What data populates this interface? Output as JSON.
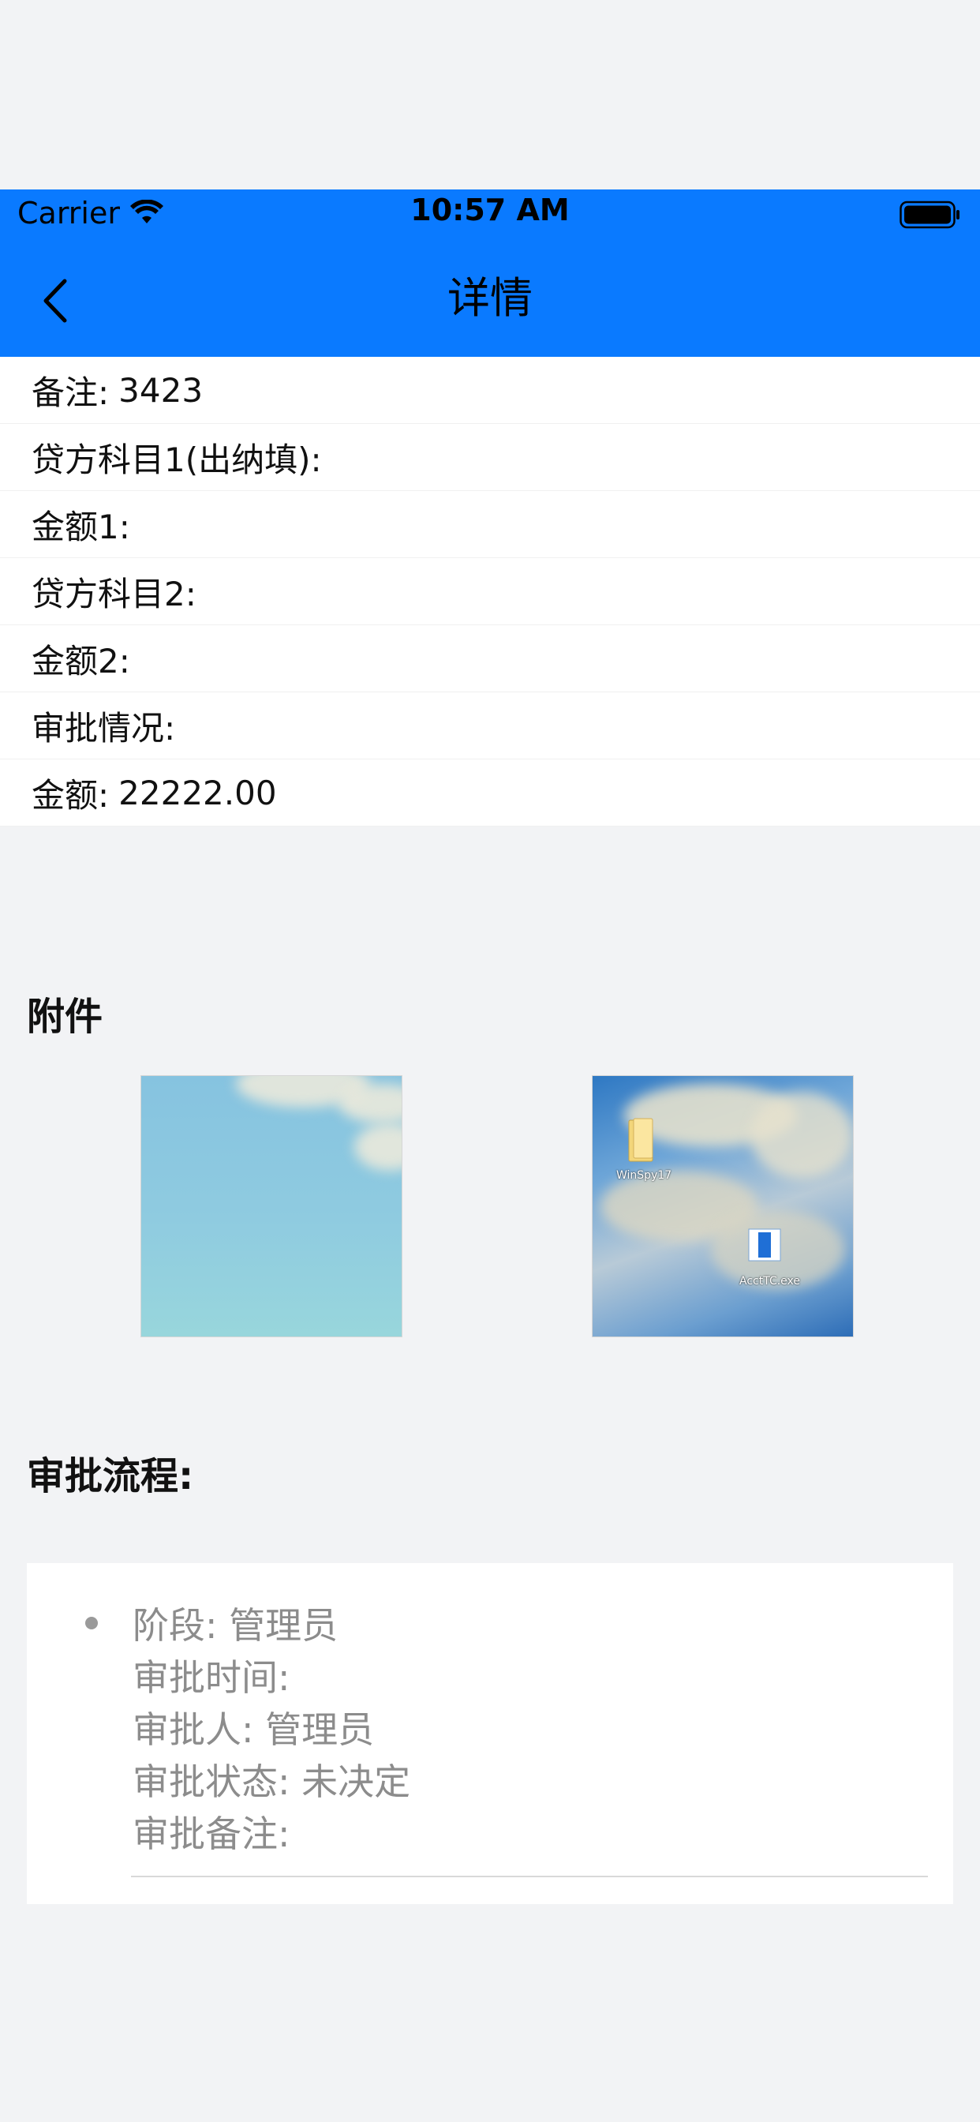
{
  "status_bar": {
    "carrier": "Carrier",
    "time": "10:57 AM"
  },
  "nav": {
    "title": "详情"
  },
  "fields": [
    {
      "label": "备注:",
      "value": "3423"
    },
    {
      "label": "贷方科目1(出纳填):",
      "value": ""
    },
    {
      "label": "金额1:",
      "value": ""
    },
    {
      "label": "贷方科目2:",
      "value": ""
    },
    {
      "label": "金额2:",
      "value": ""
    },
    {
      "label": "审批情况:",
      "value": ""
    },
    {
      "label": "金额:",
      "value": "22222.00"
    }
  ],
  "attachments": {
    "title": "附件",
    "items": [
      {
        "name": "sky-image"
      },
      {
        "name": "desktop-screenshot",
        "icons": [
          "WinSpy17",
          "AcctTC.exe"
        ]
      }
    ]
  },
  "approval": {
    "title": "审批流程:",
    "steps": [
      {
        "stage": "阶段:  管理员",
        "time": "审批时间:",
        "approver": "审批人:  管理员",
        "status": "审批状态:  未决定",
        "remark": "审批备注:"
      }
    ]
  },
  "colors": {
    "nav_bg": "#0a7aff",
    "page_bg": "#f2f3f5"
  }
}
